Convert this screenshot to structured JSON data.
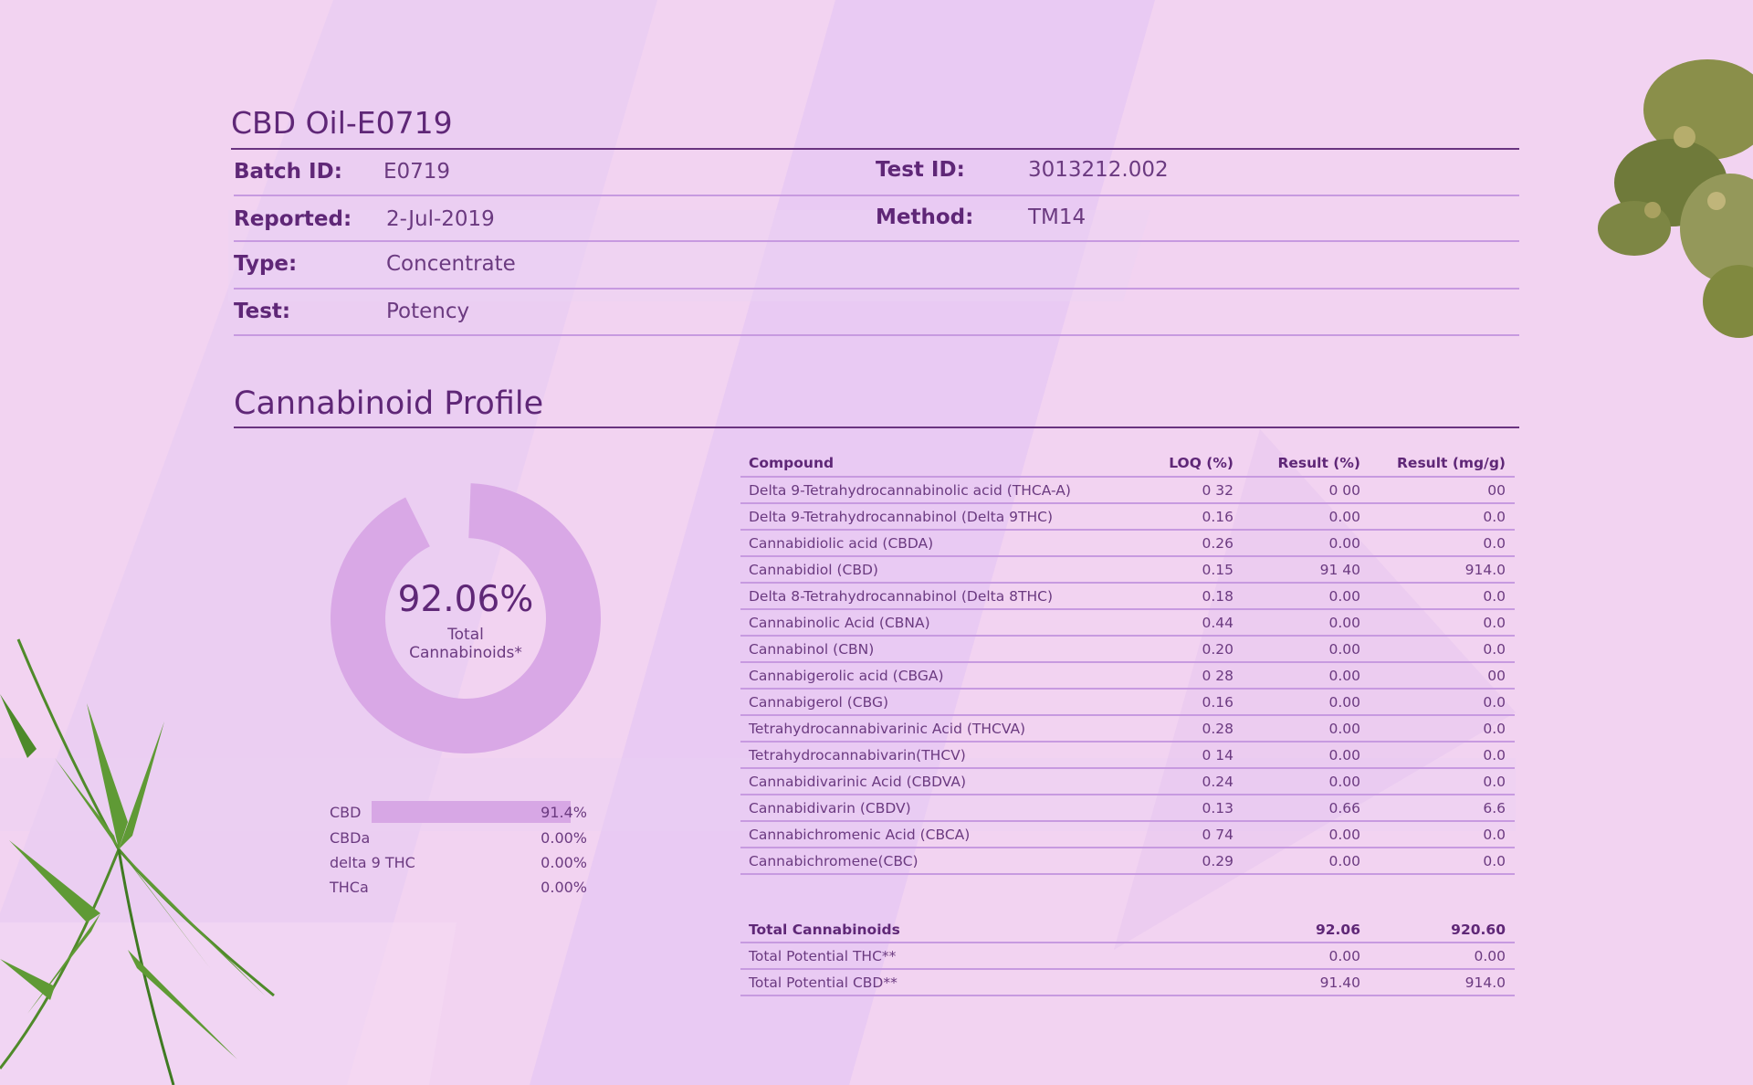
{
  "header": {
    "title": "CBD Oil-E0719"
  },
  "info": {
    "batch_label": "Batch ID:",
    "batch_value": "E0719",
    "test_id_label": "Test ID:",
    "test_id_value": "3013212.002",
    "reported_label": "Reported:",
    "reported_value": "2-Jul-2019",
    "method_label": "Method:",
    "method_value": "TM14",
    "type_label": "Type:",
    "type_value": "Concentrate",
    "test_label": "Test:",
    "test_value": "Potency"
  },
  "profile": {
    "title": "Cannabinoid Profile",
    "donut": {
      "value": "92.06%",
      "label_line1": "Total",
      "label_line2": "Cannabinoids*",
      "fraction": 0.9206,
      "color": "#d9a8e6"
    },
    "legend": [
      {
        "name": "CBD",
        "value": "91.4%",
        "fraction": 0.914
      },
      {
        "name": "CBDa",
        "value": "0.00%",
        "fraction": 0
      },
      {
        "name": "delta 9 THC",
        "value": "0.00%",
        "fraction": 0
      },
      {
        "name": "THCa",
        "value": "0.00%",
        "fraction": 0
      }
    ]
  },
  "table": {
    "headers": [
      "Compound",
      "LOQ (%)",
      "Result (%)",
      "Result (mg/g)"
    ],
    "rows": [
      [
        "Delta 9-Tetrahydrocannabinolic acid (THCA-A)",
        "0 32",
        "0 00",
        "00"
      ],
      [
        "Delta 9-Tetrahydrocannabinol (Delta 9THC)",
        "0.16",
        "0.00",
        "0.0"
      ],
      [
        "Cannabidiolic acid (CBDA)",
        "0.26",
        "0.00",
        "0.0"
      ],
      [
        "Cannabidiol (CBD)",
        "0.15",
        "91 40",
        "914.0"
      ],
      [
        "Delta 8-Tetrahydrocannabinol (Delta 8THC)",
        "0.18",
        "0.00",
        "0.0"
      ],
      [
        "Cannabinolic Acid (CBNA)",
        "0.44",
        "0.00",
        "0.0"
      ],
      [
        "Cannabinol (CBN)",
        "0.20",
        "0.00",
        "0.0"
      ],
      [
        "Cannabigerolic acid (CBGA)",
        "0 28",
        "0.00",
        "00"
      ],
      [
        "Cannabigerol (CBG)",
        "0.16",
        "0.00",
        "0.0"
      ],
      [
        "Tetrahydrocannabivarinic Acid (THCVA)",
        "0.28",
        "0.00",
        "0.0"
      ],
      [
        "Tetrahydrocannabivarin(THCV)",
        "0 14",
        "0.00",
        "0.0"
      ],
      [
        "Cannabidivarinic Acid (CBDVA)",
        "0.24",
        "0.00",
        "0.0"
      ],
      [
        "Cannabidivarin (CBDV)",
        "0.13",
        "0.66",
        "6.6"
      ],
      [
        "Cannabichromenic Acid (CBCA)",
        "0 74",
        "0.00",
        "0.0"
      ],
      [
        "Cannabichromene(CBC)",
        "0.29",
        "0.00",
        "0.0"
      ]
    ],
    "totals": [
      [
        "Total Cannabinoids",
        "",
        "92.06",
        "920.60"
      ],
      [
        "Total Potential THC**",
        "",
        "0.00",
        "0.00"
      ],
      [
        "Total Potential CBD**",
        "",
        "91.40",
        "914.0"
      ]
    ]
  },
  "colors": {
    "background": "#f2d3f1",
    "accent": "#5f2777",
    "rule": "#c79ae0",
    "chart_fill": "#d9a8e6"
  }
}
